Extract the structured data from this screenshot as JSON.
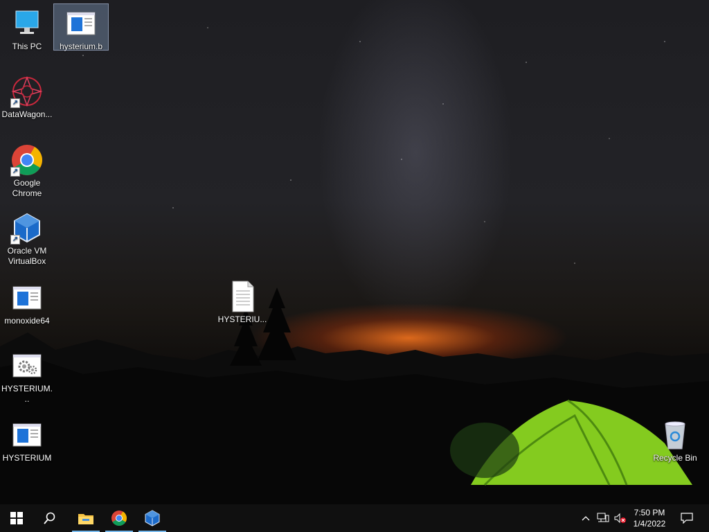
{
  "desktop": {
    "icons": [
      {
        "label": "This PC"
      },
      {
        "label": "hysterium.b"
      },
      {
        "label": "DataWagon..."
      },
      {
        "label": "Google Chrome"
      },
      {
        "label": "Oracle VM VirtualBox"
      },
      {
        "label": "monoxide64"
      },
      {
        "label": "HYSTERIU..."
      },
      {
        "label": "HYSTERIUM..."
      },
      {
        "label": "HYSTERIUM"
      },
      {
        "label": "Recycle Bin"
      }
    ]
  },
  "taskbar": {
    "clock_time": "7:50 PM",
    "clock_date": "1/4/2022",
    "accent": "#76b9ed",
    "pinned": [
      "file-explorer-icon",
      "chrome-icon",
      "virtualbox-icon"
    ]
  }
}
